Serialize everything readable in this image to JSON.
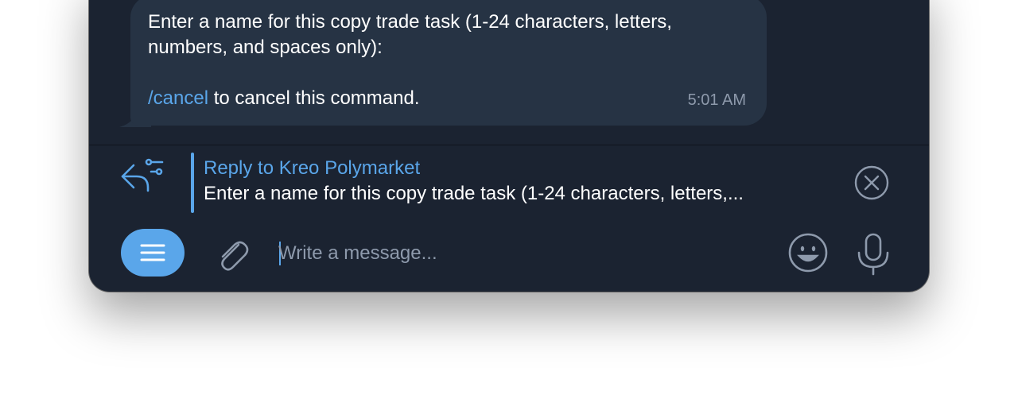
{
  "message": {
    "line1": "Enter a name for this copy trade task (1-24 characters, letters,",
    "line2": "numbers, and spaces only):",
    "command": "/cancel",
    "command_suffix": " to cancel this command.",
    "time": "5:01 AM"
  },
  "reply": {
    "title": "Reply to Kreo Polymarket",
    "snippet": "Enter a name for this copy trade task (1-24 characters, letters,..."
  },
  "composer": {
    "placeholder": "Write a message..."
  },
  "icons": {
    "reply": "reply-icon",
    "close": "close-circle-icon",
    "menu": "menu-icon",
    "attach": "paperclip-icon",
    "emoji": "emoji-icon",
    "mic": "microphone-icon"
  },
  "colors": {
    "background": "#1b2331",
    "bubble": "#263344",
    "accent": "#5aa6ea",
    "muted": "#8e9aac"
  }
}
